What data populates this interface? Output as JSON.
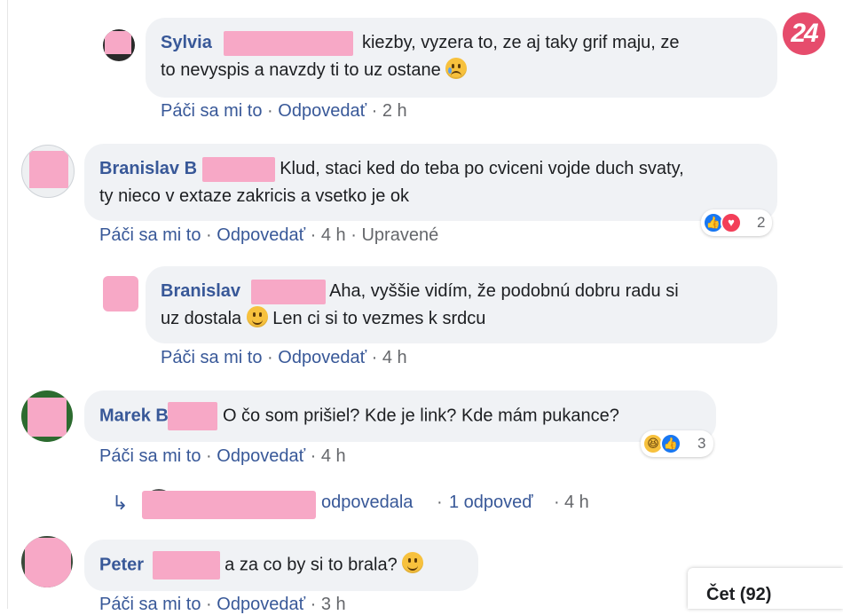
{
  "badge": "24",
  "labels": {
    "like": "Páči sa mi to",
    "reply": "Odpovedať",
    "sep": "·",
    "edited": "Upravené"
  },
  "comments": [
    {
      "name": "Sylvia",
      "text_line1": "kiezby, vyzera to, ze aj taky grif maju, ze",
      "text_line2": "to nevyspis a navzdy ti to uz ostane",
      "time": "2 h"
    },
    {
      "name": "Branislav B",
      "text_line1": "Klud, staci ked do teba po cviceni vojde duch svaty,",
      "text_line2": "ty nieco v extaze zakricis a vsetko je ok",
      "time": "4 h",
      "reaction_count": "2"
    },
    {
      "name": "Branislav",
      "text_line1": "Aha, vyššie vidím, že podobnú dobru radu si",
      "text_line2_a": "uz dostala",
      "text_line2_b": "Len ci si to vezmes k srdcu",
      "time": "4 h"
    },
    {
      "name": "Marek B",
      "text_line1": "O čo som prišiel? Kde je link? Kde mám pukance?",
      "time": "4 h",
      "reaction_count": "3"
    },
    {
      "name": "Peter",
      "text_line1": "a za co by si to brala?",
      "time": "3 h"
    }
  ],
  "reply_summary": {
    "verb": "odpovedala",
    "count": "1 odpoveď",
    "time": "4 h"
  },
  "chat": {
    "label": "Čet (92)"
  }
}
